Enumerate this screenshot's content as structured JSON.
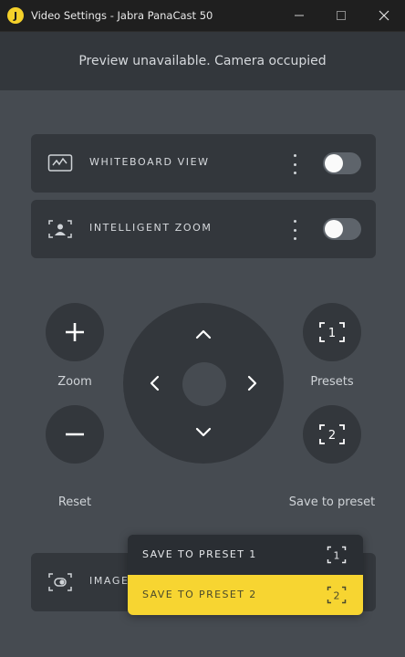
{
  "window": {
    "title": "Video Settings - Jabra PanaCast 50",
    "app_icon_letter": "J"
  },
  "preview": {
    "message": "Preview unavailable. Camera occupied"
  },
  "cards": [
    {
      "label": "WHITEBOARD VIEW",
      "icon": "whiteboard-icon",
      "toggle_on": false
    },
    {
      "label": "INTELLIGENT ZOOM",
      "icon": "intelligent-zoom-icon",
      "toggle_on": false
    },
    {
      "label": "IMAGE",
      "icon": "image-quality-icon",
      "toggle_on": false
    }
  ],
  "controls": {
    "zoom_label": "Zoom",
    "reset_label": "Reset",
    "presets_label": "Presets",
    "save_to_preset_label": "Save to preset",
    "preset_1_text": "1",
    "preset_2_text": "2"
  },
  "dropdown": {
    "items": [
      {
        "label": "SAVE TO PRESET 1",
        "number": "1",
        "highlighted": false
      },
      {
        "label": "SAVE TO PRESET 2",
        "number": "2",
        "highlighted": true
      }
    ]
  },
  "colors": {
    "accent": "#f7d531",
    "background": "#464b51",
    "panel": "#33373c"
  }
}
